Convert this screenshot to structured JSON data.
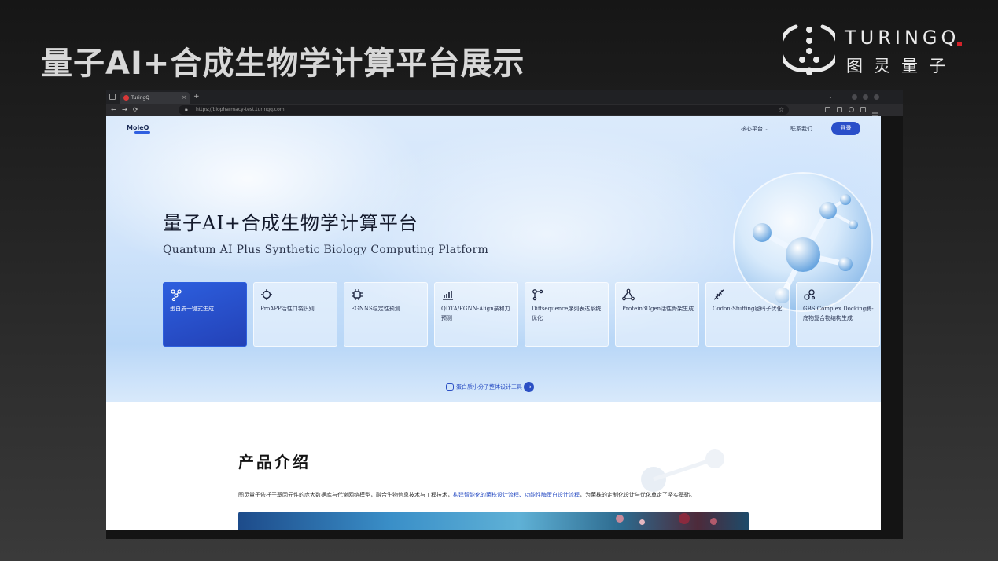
{
  "slide": {
    "title": "量子AI+合成生物学计算平台展示",
    "logo_en": "TURINGQ",
    "logo_cn": "图灵量子"
  },
  "browser": {
    "tab_title": "TuringQ",
    "tab_close": "×",
    "new_tab": "+",
    "url": "https://biopharmacy-test.turingq.com",
    "back": "←",
    "forward": "→",
    "reload": "⟳",
    "star": "☆",
    "chevron": "⌄"
  },
  "site": {
    "brand": "MoleQ",
    "nav": {
      "platform": "核心平台 ⌄",
      "contact": "联系我们",
      "login": "登录"
    },
    "hero": {
      "title": "量子AI+合成生物学计算平台",
      "subtitle": "Quantum AI Plus Synthetic Biology Computing Platform"
    },
    "cards": [
      {
        "label": "蛋白质一键式生成",
        "icon": "protein-network-icon",
        "active": true
      },
      {
        "label": "ProAPP活性口袋识别",
        "icon": "crosshair-icon",
        "active": false
      },
      {
        "label": "EGNNS稳定性预测",
        "icon": "chip-icon",
        "active": false
      },
      {
        "label": "QDTA/FGNN-Align亲和力预测",
        "icon": "bar-chart-icon",
        "active": false
      },
      {
        "label": "Diffsequence序列表达系统优化",
        "icon": "nodes-icon",
        "active": false
      },
      {
        "label": "Protein3Dgen活性骨架生成",
        "icon": "triangle-nodes-icon",
        "active": false
      },
      {
        "label": "Codon-Stuffing密码子优化",
        "icon": "dna-icon",
        "active": false
      },
      {
        "label": "GBS Complex Docking酶-底物复合物结构生成",
        "icon": "molecule-icon",
        "active": false
      }
    ],
    "tool_link": "蛋白质小分子整体设计工具",
    "tool_arrow": "→",
    "intro_section": {
      "title": "产品介绍",
      "text_before": "图灵量子依托于基因元件的庞大数据库与代谢网络模型，融合生物信息技术与工程技术，",
      "highlight1": "构建智能化的菌株设计流程",
      "sep": "、",
      "highlight2": "功能性酶蛋白设计流程",
      "text_after": "，为菌株的定制化设计与优化奠定了坚实基础。"
    }
  },
  "colors": {
    "accent": "#2a4fc9",
    "logo_red": "#d2232a"
  }
}
